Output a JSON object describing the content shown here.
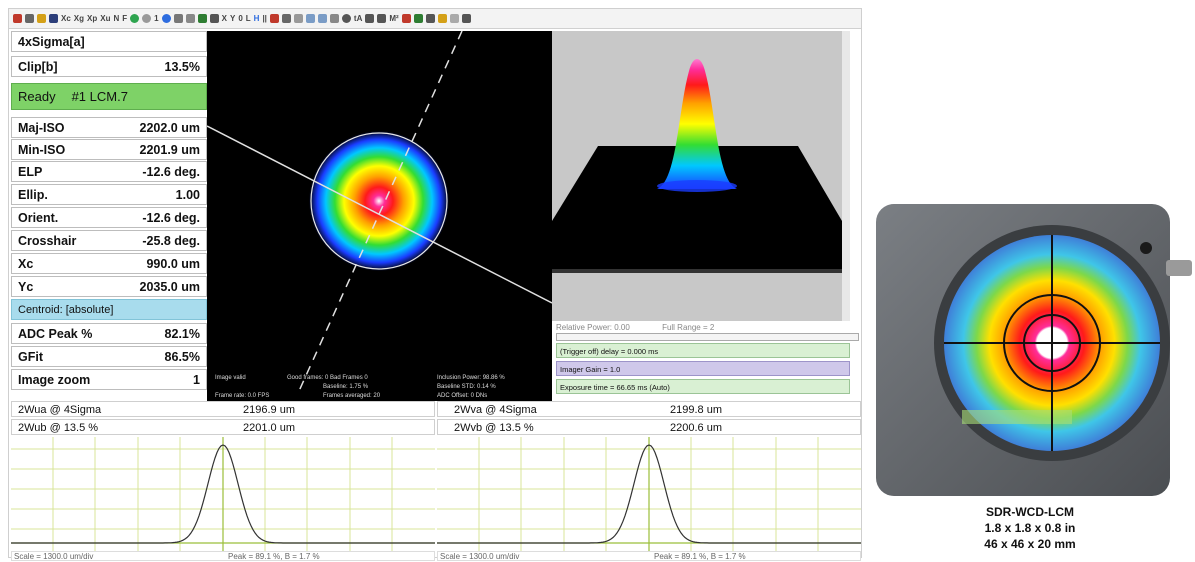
{
  "measurements": [
    {
      "label": "4xSigma[a]",
      "value": ""
    },
    {
      "label": "Clip[b]",
      "value": "13.5%"
    }
  ],
  "status": {
    "state": "Ready",
    "device": "#1 LCM.7"
  },
  "results": [
    {
      "label": "Maj-ISO",
      "value": "2202.0 um"
    },
    {
      "label": "Min-ISO",
      "value": "2201.9 um"
    },
    {
      "label": "ELP",
      "value": "-12.6 deg."
    },
    {
      "label": "Ellip.",
      "value": "1.00"
    },
    {
      "label": "Orient.",
      "value": "-12.6 deg."
    },
    {
      "label": "Crosshair",
      "value": "-25.8 deg."
    },
    {
      "label": "Xc",
      "value": "990.0 um"
    },
    {
      "label": "Yc",
      "value": "2035.0 um"
    }
  ],
  "centroid_label": "Centroid: [absolute]",
  "extra": [
    {
      "label": "ADC Peak %",
      "value": "82.1%"
    },
    {
      "label": "GFit",
      "value": "86.5%"
    },
    {
      "label": "Image zoom",
      "value": "1"
    }
  ],
  "beam_info": {
    "image_valid": "Image valid",
    "good_frames": "Good frames: 0 Bad Frames 0",
    "baseline": "Baseline: 1.75 %",
    "frames_averaged": "Frames averaged: 20",
    "frame_rate": "Frame rate: 0.0 FPS",
    "inclusion_power": "Inclusion Power: 98.86 %",
    "baseline_std": "Baseline STD: 0.14 %",
    "adc_offset": "ADC Offset: 0 DNs"
  },
  "controls": {
    "relative_power": "Relative Power: 0.00",
    "full_range": "Full Range = 2",
    "trigger": "(Trigger off) delay = 0.000 ms",
    "gain": "Imager Gain = 1.0",
    "exposure": "Exposure time = 66.65 ms (Auto)"
  },
  "profiles": {
    "left": {
      "w4s_label": "2Wua @ 4Sigma",
      "w4s_value": "2196.9 um",
      "w13_label": "2Wub @ 13.5 %",
      "w13_value": "2201.0 um",
      "scale": "Scale = 1300.0 um/div",
      "peak": "Peak = 89.1 %, B = 1.7 %"
    },
    "right": {
      "w4s_label": "2Wva @ 4Sigma",
      "w4s_value": "2199.8 um",
      "w13_label": "2Wvb @ 13.5 %",
      "w13_value": "2200.6 um",
      "scale": "Scale = 1300.0 um/div",
      "peak": "Peak = 89.1 %, B = 1.7 %"
    }
  },
  "product": {
    "name": "SDR-WCD-LCM",
    "size_in": "1.8 x 1.8 x 0.8 in",
    "size_mm": "46 x 46 x 20 mm"
  },
  "colors": {
    "ready": "#7ed267",
    "centroid": "#a8dced",
    "control_green": "#d9f0d3",
    "control_purple": "#cfc8ea",
    "camera_body": "#5a5e63"
  },
  "icons": [
    "up-arrow-icon",
    "pencil-icon",
    "folder-icon",
    "save-icon",
    "crosshair-icon",
    "gear-icon",
    "camera-icon",
    "grid-icon",
    "print-icon"
  ]
}
